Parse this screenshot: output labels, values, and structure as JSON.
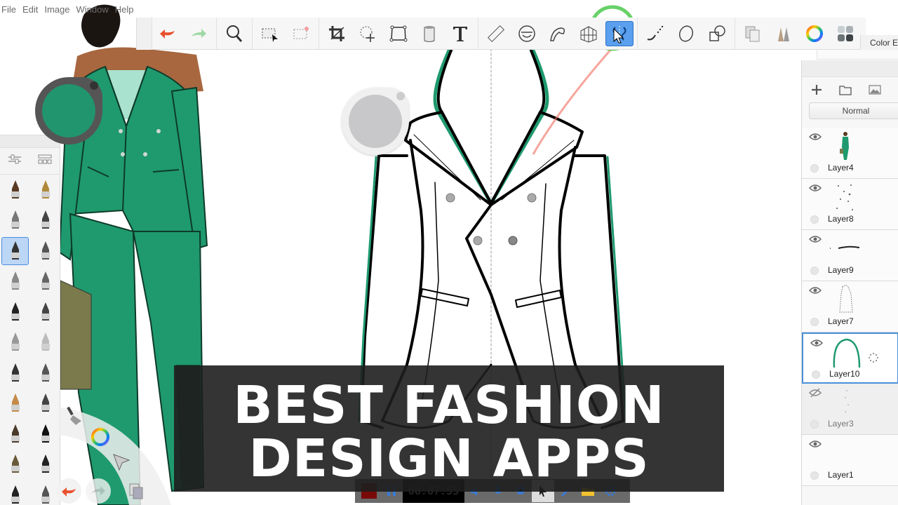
{
  "menu": {
    "items": [
      "File",
      "Edit",
      "Image",
      "Window",
      "Help"
    ]
  },
  "toolbar": {
    "tools": [
      {
        "name": "undo",
        "icon": "undo-arrow-icon"
      },
      {
        "name": "redo",
        "icon": "redo-arrow-icon"
      },
      {
        "name": "zoom",
        "icon": "magnifier-icon"
      },
      {
        "name": "selection",
        "icon": "rect-select-icon"
      },
      {
        "name": "clear-selection",
        "icon": "deselect-icon"
      },
      {
        "name": "crop",
        "icon": "crop-icon"
      },
      {
        "name": "transform",
        "icon": "lasso-move-icon"
      },
      {
        "name": "distort",
        "icon": "distort-icon"
      },
      {
        "name": "fill",
        "icon": "paint-bucket-icon"
      },
      {
        "name": "text",
        "icon": "text-icon"
      },
      {
        "name": "ruler",
        "icon": "ruler-icon"
      },
      {
        "name": "ellipse-guide",
        "icon": "ellipse-guide-icon"
      },
      {
        "name": "french-curve",
        "icon": "french-curve-icon"
      },
      {
        "name": "perspective",
        "icon": "perspective-grid-icon"
      },
      {
        "name": "symmetry",
        "icon": "symmetry-icon",
        "active": true
      },
      {
        "name": "steady-stroke",
        "icon": "steady-stroke-icon"
      },
      {
        "name": "predictive-stroke",
        "icon": "ellipse-stroke-icon"
      },
      {
        "name": "shapes",
        "icon": "shapes-icon"
      },
      {
        "name": "layers",
        "icon": "layers-icon"
      },
      {
        "name": "brush-library",
        "icon": "brush-library-icon"
      },
      {
        "name": "color-wheel",
        "icon": "color-wheel-icon"
      },
      {
        "name": "copic-library",
        "icon": "swatches-icon"
      }
    ],
    "highlight_color": "#4cc94c"
  },
  "right_tab": {
    "label": "Color E"
  },
  "layers_panel": {
    "blend_mode": "Normal",
    "actions": [
      "add-layer",
      "add-group",
      "add-image"
    ],
    "layers": [
      {
        "name": "Layer4",
        "visible": true,
        "selected": false
      },
      {
        "name": "Layer8",
        "visible": true,
        "selected": false
      },
      {
        "name": "Layer9",
        "visible": true,
        "selected": false
      },
      {
        "name": "Layer7",
        "visible": true,
        "selected": false
      },
      {
        "name": "Layer10",
        "visible": true,
        "selected": true
      },
      {
        "name": "Layer3",
        "visible": false,
        "selected": false
      },
      {
        "name": "Layer1",
        "visible": true,
        "selected": false
      }
    ]
  },
  "brush_palette": {
    "header_tools": [
      "brush-properties",
      "brush-sets"
    ],
    "brushes": [
      "felt-tip",
      "smudge-ring",
      "airbrush",
      "hard-edge-marker",
      "ballpoint-pen",
      "fountain-pen",
      "marker",
      "inking-pen",
      "spray-dots",
      "texture-chain",
      "eraser",
      "chisel-marker",
      "scribble",
      "technical-pen",
      "pencil",
      "sb-pencil",
      "paint-brush",
      "s-brush",
      "bell-airbrush",
      "splatter",
      "fan-brush",
      "hatching"
    ],
    "selected_index": 4
  },
  "color_puck": {
    "active_color": "#21956e",
    "secondary_color": "#c8c7c9"
  },
  "lagoon": {
    "items": [
      "brush-icon",
      "color-wheel-icon",
      "pointer-icon",
      "layers-icon",
      "undo-icon",
      "redo-icon"
    ]
  },
  "recorder": {
    "timer": "00:07:55",
    "buttons": [
      "stop",
      "pause",
      "speaker",
      "microphone",
      "webcam",
      "cursor",
      "pen",
      "folder",
      "settings"
    ]
  },
  "title_overlay": {
    "line1": "BEST FASHION",
    "line2": "DESIGN APPS"
  },
  "colors": {
    "garment_green": "#1f9a6e",
    "undo_red": "#e8502e",
    "redo_green": "#9fd8a3",
    "selection_blue": "#4a90d9"
  }
}
